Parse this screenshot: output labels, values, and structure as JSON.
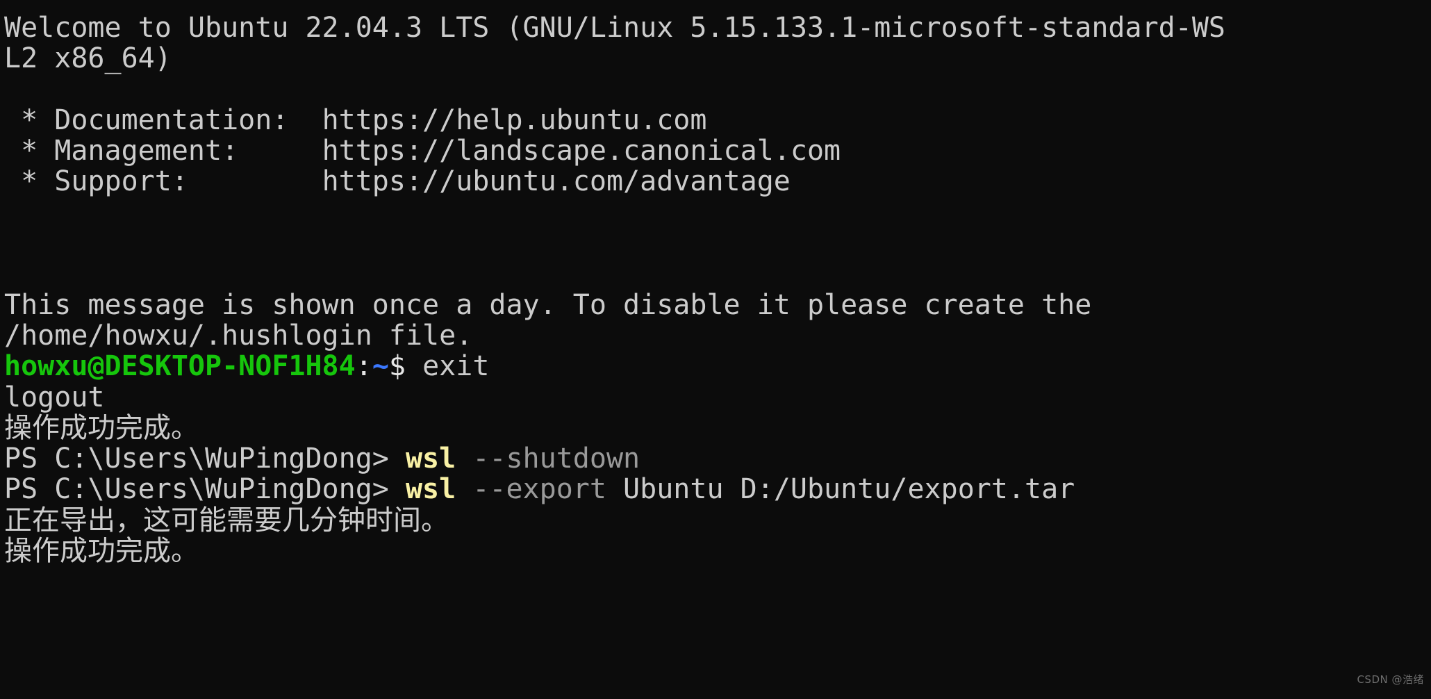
{
  "terminal": {
    "background_color": "#0c0c0c",
    "foreground_color": "#cccccc",
    "colors": {
      "green": "#16c60c",
      "blue": "#3b78ff",
      "yellow": "#f9f1a5",
      "gray": "#9a9a9a",
      "white": "#e5e5e5"
    },
    "lines": {
      "welcome_1": "Welcome to Ubuntu 22.04.3 LTS (GNU/Linux 5.15.133.1-microsoft-standard-WS",
      "welcome_2": "L2 x86_64)",
      "blank_1": "",
      "doc_label": " * Documentation:  ",
      "doc_url": "https://help.ubuntu.com",
      "mgmt_label": " * Management:     ",
      "mgmt_url": "https://landscape.canonical.com",
      "support_label": " * Support:        ",
      "support_url": "https://ubuntu.com/advantage",
      "blank_2": "",
      "blank_3": "",
      "blank_4": "",
      "notice_1": "This message is shown once a day. To disable it please create the",
      "notice_2": "/home/howxu/.hushlogin file.",
      "prompt_user": "howxu@DESKTOP-NOF1H84",
      "prompt_colon": ":",
      "prompt_path": "~",
      "prompt_sigil": "$ ",
      "prompt_command": "exit",
      "logout": "logout",
      "zh_success_1": "操作成功完成。",
      "ps_prompt_1": "PS C:\\Users\\WuPingDong> ",
      "ps_cmd_1_name": "wsl",
      "ps_cmd_1_space": " ",
      "ps_cmd_1_flag": "--shutdown",
      "ps_prompt_2": "PS C:\\Users\\WuPingDong> ",
      "ps_cmd_2_name": "wsl",
      "ps_cmd_2_space": " ",
      "ps_cmd_2_flag": "--export",
      "ps_cmd_2_args": " Ubuntu D:/Ubuntu/export.tar",
      "zh_exporting": "正在导出，这可能需要几分钟时间。",
      "zh_success_2": "操作成功完成。"
    }
  },
  "watermark": {
    "text": "CSDN @浩绪"
  }
}
